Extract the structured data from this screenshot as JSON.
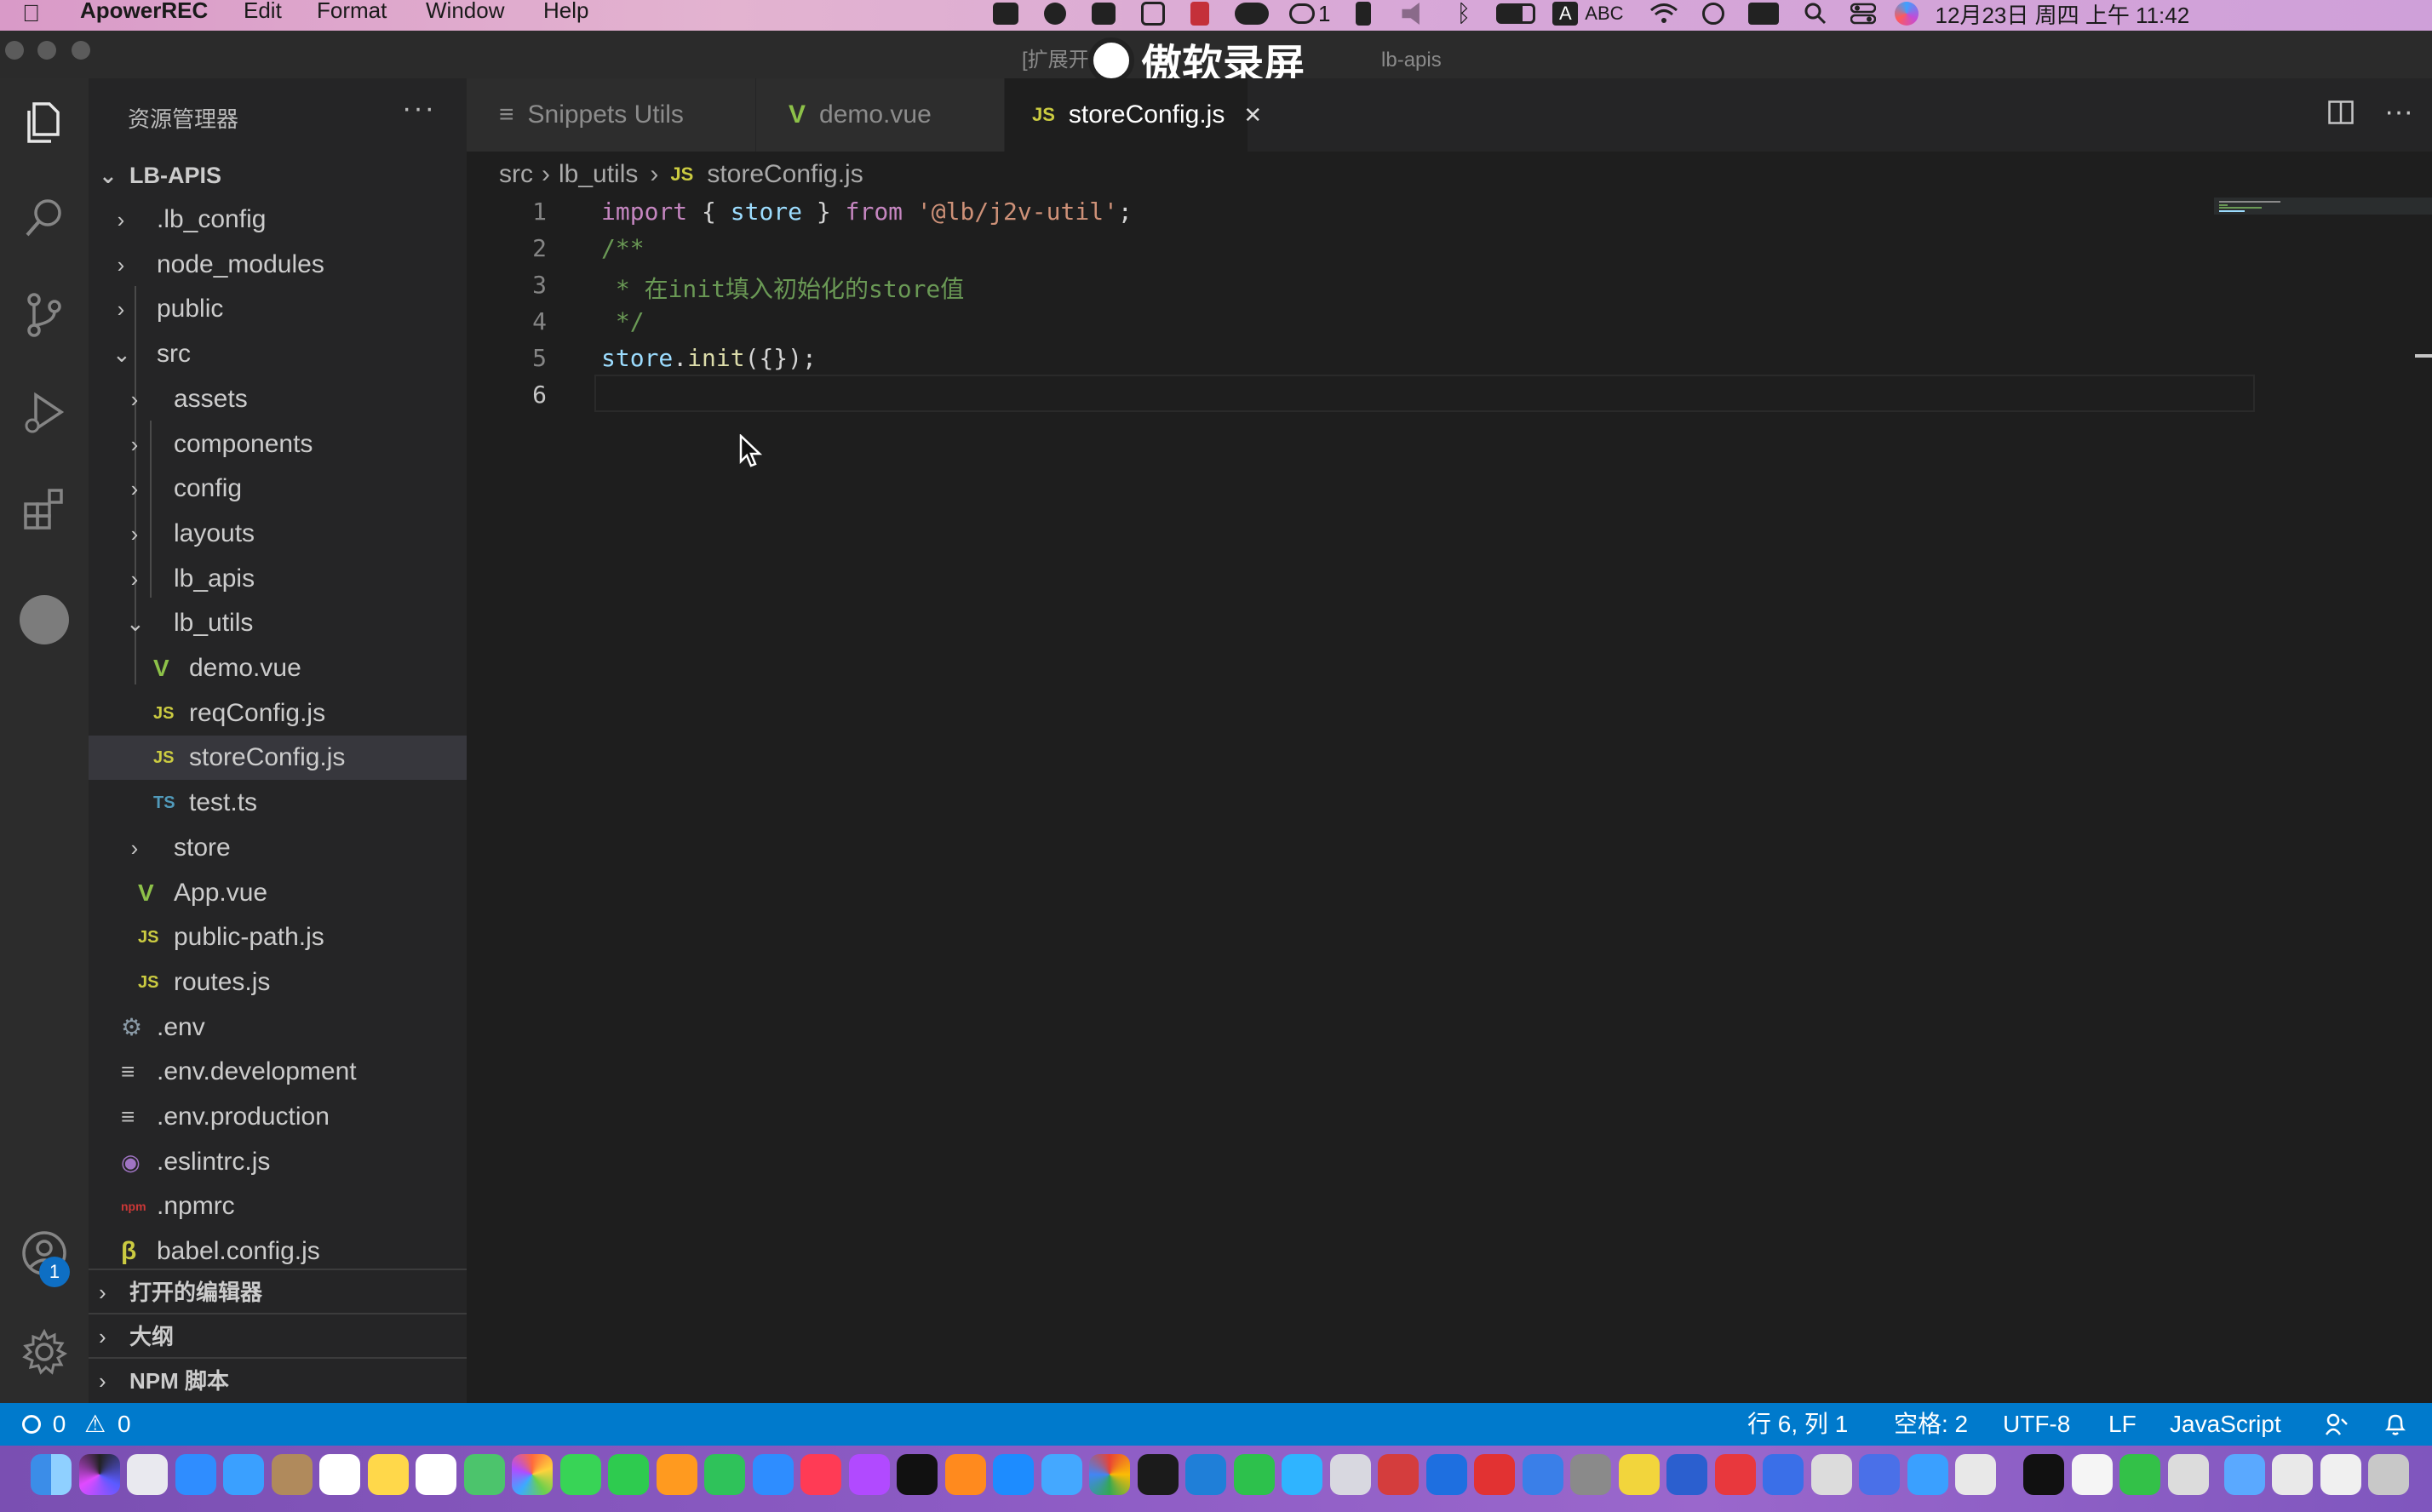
{
  "menubar": {
    "app_name": "ApowerREC",
    "menus": [
      "Edit",
      "Format",
      "Window",
      "Help"
    ],
    "tray": {
      "notification_count": "1",
      "input_method_letter": "A",
      "input_method": "ABC",
      "datetime": "12月23日 周四 上午 11:42"
    }
  },
  "titlebar": {
    "title_prefix": "[扩展开",
    "title_suffix": "lb-apis",
    "watermark": "傲软录屏"
  },
  "activity_bar": {
    "accounts_badge": "1"
  },
  "sidebar": {
    "title": "资源管理器",
    "more": "···",
    "root": "LB-APIS",
    "tree": [
      {
        "label": ".lb_config",
        "type": "folder",
        "expanded": false,
        "depth": 1
      },
      {
        "label": "node_modules",
        "type": "folder",
        "expanded": false,
        "depth": 1
      },
      {
        "label": "public",
        "type": "folder",
        "expanded": false,
        "depth": 1
      },
      {
        "label": "src",
        "type": "folder",
        "expanded": true,
        "depth": 1
      },
      {
        "label": "assets",
        "type": "folder",
        "expanded": false,
        "depth": 2
      },
      {
        "label": "components",
        "type": "folder",
        "expanded": false,
        "depth": 2
      },
      {
        "label": "config",
        "type": "folder",
        "expanded": false,
        "depth": 2
      },
      {
        "label": "layouts",
        "type": "folder",
        "expanded": false,
        "depth": 2
      },
      {
        "label": "lb_apis",
        "type": "folder",
        "expanded": false,
        "depth": 2
      },
      {
        "label": "lb_utils",
        "type": "folder",
        "expanded": true,
        "depth": 2
      },
      {
        "label": "demo.vue",
        "type": "vue",
        "depth": 3
      },
      {
        "label": "reqConfig.js",
        "type": "js",
        "depth": 3
      },
      {
        "label": "storeConfig.js",
        "type": "js",
        "depth": 3,
        "selected": true
      },
      {
        "label": "test.ts",
        "type": "ts",
        "depth": 3
      },
      {
        "label": "store",
        "type": "folder",
        "expanded": false,
        "depth": 2
      },
      {
        "label": "App.vue",
        "type": "vue",
        "depth": 2
      },
      {
        "label": "public-path.js",
        "type": "js",
        "depth": 2
      },
      {
        "label": "routes.js",
        "type": "js",
        "depth": 2
      },
      {
        "label": ".env",
        "type": "gear",
        "depth": 1
      },
      {
        "label": ".env.development",
        "type": "lines",
        "depth": 1
      },
      {
        "label": ".env.production",
        "type": "lines",
        "depth": 1
      },
      {
        "label": ".eslintrc.js",
        "type": "eslint",
        "depth": 1
      },
      {
        "label": ".npmrc",
        "type": "npm",
        "depth": 1
      },
      {
        "label": "babel.config.js",
        "type": "babel",
        "depth": 1
      }
    ],
    "sections": [
      "打开的编辑器",
      "大纲",
      "NPM 脚本"
    ]
  },
  "tabs": [
    {
      "label": "Snippets Utils",
      "icon": "≡",
      "active": false
    },
    {
      "label": "demo.vue",
      "icon": "V",
      "active": false
    },
    {
      "label": "storeConfig.js",
      "icon": "JS",
      "active": true,
      "close": "✕"
    }
  ],
  "breadcrumb": {
    "parts": [
      "src",
      "lb_utils"
    ],
    "file_icon": "JS",
    "file": "storeConfig.js",
    "sep": "›"
  },
  "editor": {
    "line_numbers": [
      "1",
      "2",
      "3",
      "4",
      "5",
      "6"
    ],
    "line1": {
      "kw1": "import",
      "p1": " { ",
      "v1": "store",
      "p2": " } ",
      "kw2": "from",
      "p3": " ",
      "str": "'@lb/j2v-util'",
      "p4": ";"
    },
    "line2": "/**",
    "line3": " * 在init填入初始化的store值",
    "line4": " */",
    "line5": {
      "v": "store",
      "p1": ".",
      "fn": "init",
      "p2": "({});"
    }
  },
  "status": {
    "errors": "0",
    "warnings": "0",
    "position": "行 6, 列 1",
    "indent": "空格: 2",
    "encoding": "UTF-8",
    "eol": "LF",
    "language": "JavaScript"
  },
  "colors": {
    "status_bar": "#007acc",
    "editor_bg": "#1e1e1e",
    "sidebar_bg": "#252526",
    "js_icon": "#cbcb41",
    "vue_icon": "#8dc149",
    "ts_icon": "#519aba"
  }
}
